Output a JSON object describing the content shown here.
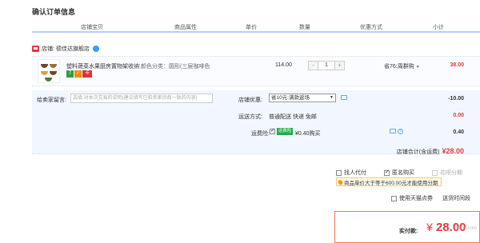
{
  "page_title": "确认订单信息",
  "columns": {
    "shop_item": "店铺宝贝",
    "attributes": "商品属性",
    "unit_price": "单价",
    "quantity": "数量",
    "promotion": "优惠方式",
    "subtotal": "小计"
  },
  "shop": {
    "label": "店铺:",
    "name": "德佳达旗舰店"
  },
  "item": {
    "title": "塑料蔬菜水果厨房置物架收纳筐...",
    "attributes": "颜色分类：圆形(三层咖啡色",
    "unit_price": "114.00",
    "quantity": "1",
    "minus": "-",
    "plus": "+",
    "promotion": "省76:周群购",
    "subtotal": "38.00",
    "badges": [
      "7",
      "✓",
      "卡"
    ]
  },
  "options": {
    "message_label": "给卖家留言:",
    "message_placeholder": "选填:对本次交易的说明(建议填写已和卖家协商一致的内容)",
    "shop_discount_label": "店铺优惠:",
    "shop_discount_value": "省10元:满款返场",
    "shop_discount_amount": "-10.00",
    "shipping_label": "运送方式:",
    "shipping_value": "普通配送 快递 免邮",
    "shipping_amount": "0.00",
    "insurance_label": "运费险:",
    "insurance_badge": "运费险",
    "insurance_value": "¥0.40购买",
    "insurance_amount": "0.40"
  },
  "shop_total": {
    "label": "店铺合计(含运费)",
    "value": "¥28.00"
  },
  "order_options": {
    "proxy": "找人代付",
    "anonymous": "匿名购买",
    "installment": "花呗分期",
    "installment_note": "商品单价大于等于600.00元才能使用分期",
    "tmall_points": "使用天猫点券",
    "delivery_time": "送货时间段"
  },
  "payment": {
    "label": "实付款:",
    "currency": "¥",
    "amount": "28.00"
  },
  "watermark": "itcui.com"
}
